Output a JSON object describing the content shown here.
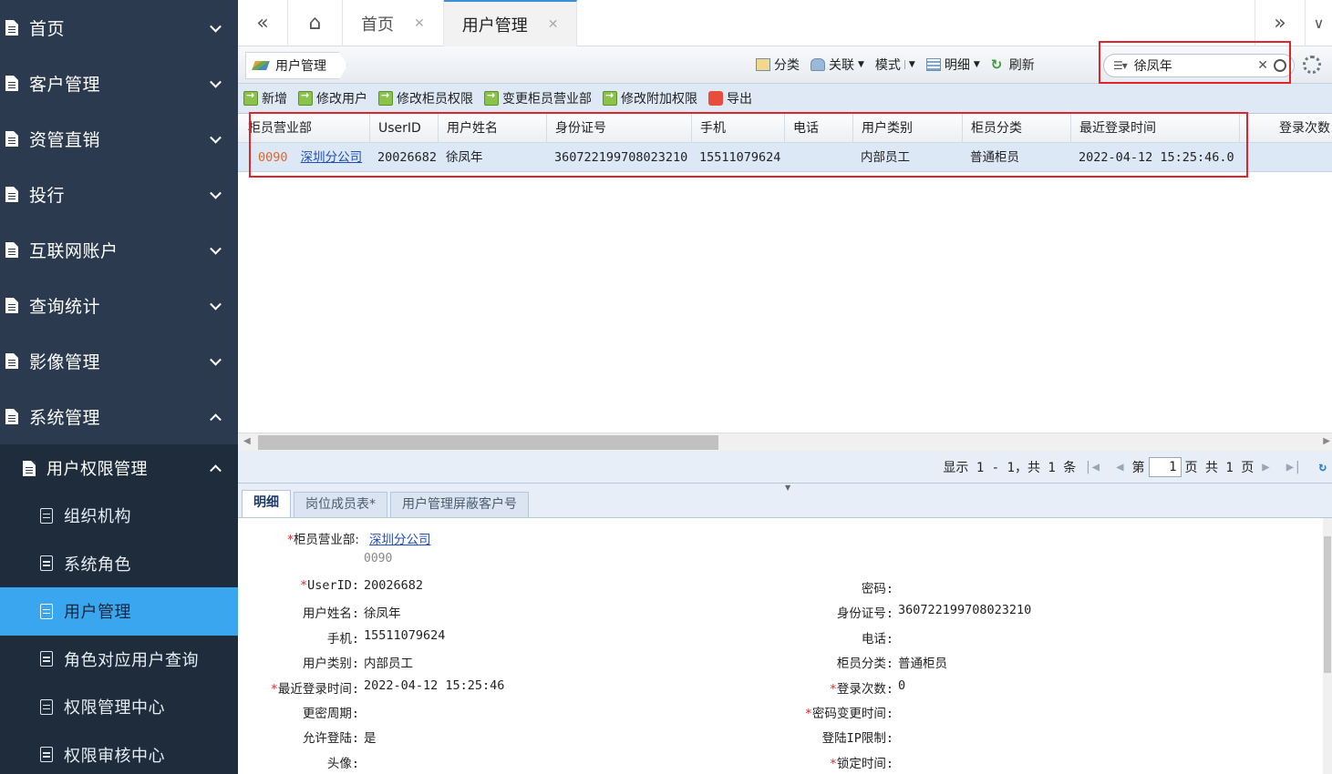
{
  "sidebar": {
    "items": [
      {
        "label": "首页"
      },
      {
        "label": "客户管理"
      },
      {
        "label": "资管直销"
      },
      {
        "label": "投行"
      },
      {
        "label": "互联网账户"
      },
      {
        "label": "查询统计"
      },
      {
        "label": "影像管理"
      },
      {
        "label": "系统管理"
      }
    ],
    "group": {
      "label": "用户权限管理"
    },
    "subitems": [
      {
        "label": "组织机构"
      },
      {
        "label": "系统角色"
      },
      {
        "label": "用户管理"
      },
      {
        "label": "角色对应用户查询"
      },
      {
        "label": "权限管理中心"
      },
      {
        "label": "权限审核中心"
      }
    ]
  },
  "tabs": [
    {
      "label": "首页"
    },
    {
      "label": "用户管理"
    }
  ],
  "breadcrumb": {
    "label": "用户管理"
  },
  "viewtools": {
    "classify": "分类",
    "relate": "关联",
    "mode": "模式",
    "detail": "明细",
    "refresh": "刷新"
  },
  "search": {
    "value": "徐凤年"
  },
  "actions": {
    "add": "新增",
    "edit_user": "修改用户",
    "edit_perm": "修改柜员权限",
    "change_dept": "变更柜员营业部",
    "edit_extra": "修改附加权限",
    "export": "导出"
  },
  "grid": {
    "columns": [
      "柜员营业部",
      "UserID",
      "用户姓名",
      "身份证号",
      "手机",
      "电话",
      "用户类别",
      "柜员分类",
      "最近登录时间",
      "登录次数"
    ],
    "row": {
      "dept_code": "0090",
      "dept_name": "深圳分公司",
      "userid": "20026682",
      "name": "徐凤年",
      "idcard": "360722199708023210",
      "mobile": "15511079624",
      "phone": "",
      "usertype": "内部员工",
      "tellertype": "普通柜员",
      "lastlogin": "2022-04-12 15:25:46.0",
      "logincount": ""
    }
  },
  "pager": {
    "summary": "显示 1 - 1，共 1 条",
    "page_prefix": "第",
    "page": "1",
    "page_suffix": "页 共 1 页"
  },
  "detail_tabs": [
    "明细",
    "岗位成员表*",
    "用户管理屏蔽客户号"
  ],
  "detail": {
    "dept_label": "柜员营业部:",
    "dept_value": "深圳分公司",
    "dept_code": "0090",
    "userid_label": "UserID:",
    "userid_value": "20026682",
    "password_label": "密码:",
    "name_label": "用户姓名:",
    "name_value": "徐凤年",
    "idcard_label": "身份证号:",
    "idcard_value": "360722199708023210",
    "mobile_label": "手机:",
    "mobile_value": "15511079624",
    "phone_label": "电话:",
    "usertype_label": "用户类别:",
    "usertype_value": "内部员工",
    "tellertype_label": "柜员分类:",
    "tellertype_value": "普通柜员",
    "lastlogin_label": "最近登录时间:",
    "lastlogin_value": "2022-04-12 15:25:46",
    "logincount_label": "登录次数:",
    "logincount_value": "0",
    "pwdcycle_label": "更密周期:",
    "pwdchange_label": "密码变更时间:",
    "allowlogin_label": "允许登陆:",
    "allowlogin_value": "是",
    "iplimit_label": "登陆IP限制:",
    "avatar_label": "头像:",
    "locktime_label": "锁定时间:",
    "required_mark": "*"
  }
}
